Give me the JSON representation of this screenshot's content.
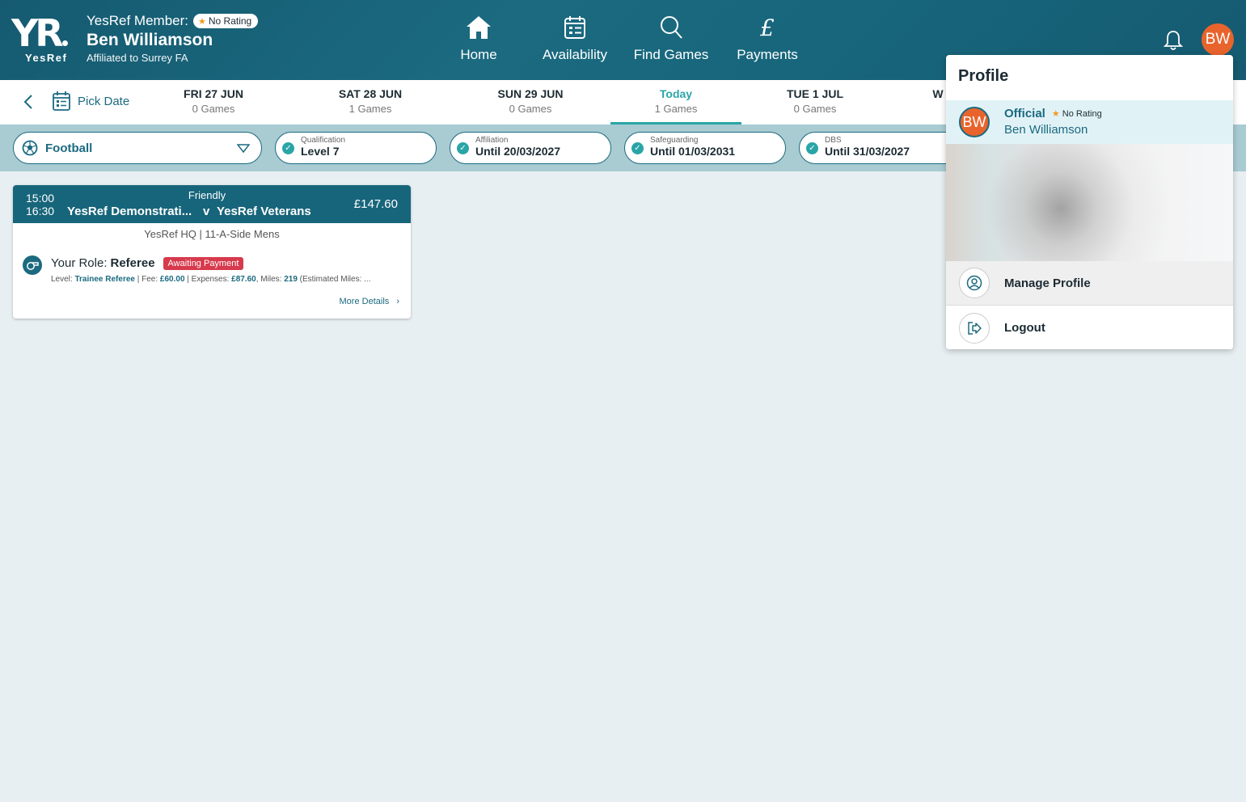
{
  "header": {
    "logo_text": "YR",
    "logo_sub": "YesRef",
    "member_label": "YesRef Member:",
    "rating_badge": "No Rating",
    "member_name": "Ben Williamson",
    "affiliation": "Affiliated to Surrey FA",
    "nav": [
      {
        "label": "Home",
        "icon": "home-icon"
      },
      {
        "label": "Availability",
        "icon": "calendar-icon"
      },
      {
        "label": "Find Games",
        "icon": "search-icon"
      },
      {
        "label": "Payments",
        "icon": "pound-icon"
      }
    ],
    "avatar_initials": "BW"
  },
  "datebar": {
    "pick_label": "Pick Date",
    "days": [
      {
        "date": "FRI 27 JUN",
        "games": "0 Games"
      },
      {
        "date": "SAT 28 JUN",
        "games": "1 Games"
      },
      {
        "date": "SUN 29 JUN",
        "games": "0 Games"
      },
      {
        "date": "Today",
        "games": "1 Games"
      },
      {
        "date": "TUE 1 JUL",
        "games": "0 Games"
      },
      {
        "date": "W",
        "games": ""
      }
    ]
  },
  "filters": {
    "sport": "Football",
    "chips": [
      {
        "label": "Qualification",
        "value": "Level 7"
      },
      {
        "label": "Affiliation",
        "value": "Until 20/03/2027"
      },
      {
        "label": "Safeguarding",
        "value": "Until 01/03/2031"
      },
      {
        "label": "DBS",
        "value": "Until 31/03/2027"
      }
    ]
  },
  "game": {
    "start": "15:00",
    "end": "16:30",
    "type": "Friendly",
    "home": "YesRef Demonstrati...",
    "vs": "v",
    "away": "YesRef Veterans",
    "price": "£147.60",
    "venue": "YesRef HQ | 11-A-Side Mens",
    "role_label": "Your Role:",
    "role": "Referee",
    "status": "Awaiting Payment",
    "level_label": "Level:",
    "level": "Trainee Referee",
    "fee_label": "|  Fee:",
    "fee": "£60.00",
    "expenses_label": "| Expenses:",
    "expenses": "£87.60",
    "miles_label": ", Miles:",
    "miles": "219",
    "estimated": "(Estimated Miles: ...",
    "more": "More Details"
  },
  "profile": {
    "title": "Profile",
    "avatar_initials": "BW",
    "role": "Official",
    "rating": "No Rating",
    "name": "Ben Williamson",
    "manage": "Manage Profile",
    "logout": "Logout"
  },
  "colors": {
    "brand": "#17657b",
    "accent": "#2aa5a7",
    "avatar": "#e8642c",
    "status_badge": "#d63a4c",
    "star": "#f39a1f"
  }
}
